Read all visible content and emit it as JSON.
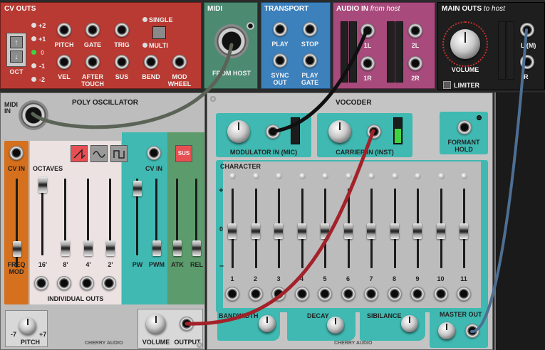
{
  "colors": {
    "cv_outs": "#b83a32",
    "midi": "#4c8a72",
    "transport": "#3c80bc",
    "audio_in": "#a84a7c",
    "main_outs": "#1e1e1e",
    "rack": "#c9c9c9",
    "teal": "#3fb9b2",
    "orange": "#d4701e",
    "green": "#5c9c6c",
    "cable_gray": "#5b6357",
    "cable_black": "#101010",
    "cable_red": "#a3222a",
    "cable_blue": "#4e6f93"
  },
  "cv_outs": {
    "title": "CV OUTS",
    "octave_label": "OCT",
    "octave_values": [
      "+2",
      "+1",
      "0",
      "-1",
      "-2"
    ],
    "active_octave": "0",
    "jacks": [
      "PITCH",
      "GATE",
      "TRIG",
      "VEL",
      "AFTER TOUCH",
      "SUS",
      "BEND",
      "MOD WHEEL"
    ],
    "mode_single": "SINGLE",
    "mode_multi": "MULTI"
  },
  "midi": {
    "title": "MIDI",
    "from_host": "FROM HOST"
  },
  "transport": {
    "title": "TRANSPORT",
    "jacks": [
      "PLAY",
      "STOP",
      "SYNC OUT",
      "PLAY GATE"
    ]
  },
  "audio_in": {
    "title": "AUDIO IN",
    "subtitle": "from host",
    "jacks": [
      "1L",
      "1R",
      "2L",
      "2R"
    ]
  },
  "main_outs": {
    "title": "MAIN OUTS",
    "subtitle": "to host",
    "volume": "VOLUME",
    "limiter": "LIMITER",
    "jacks": [
      "L (M)",
      "R"
    ]
  },
  "poly": {
    "title": "POLY OSCILLATOR",
    "midi_in": "MIDI IN",
    "cv_in": "CV IN",
    "octaves": "OCTAVES",
    "freq_mod": "FREQ MOD",
    "fader_labels": [
      "16'",
      "8'",
      "4'",
      "2'"
    ],
    "individual_outs": "INDIVIDUAL OUTS",
    "cv_in2": "CV IN",
    "sus": "SUS",
    "pw": "PW",
    "pwm": "PWM",
    "atk": "ATK",
    "rel": "REL",
    "pitch": "PITCH",
    "pitch_min": "-7",
    "pitch_max": "+7",
    "volume": "VOLUME",
    "output": "OUTPUT",
    "brand": "CHERRY AUDIO"
  },
  "vocoder": {
    "title": "VOCODER",
    "modulator": "MODULATOR IN (MIC)",
    "carrier": "CARRIER IN (INST)",
    "formant_hold": "FORMANT HOLD",
    "character": "CHARACTER",
    "scale_plus": "+",
    "scale_zero": "0",
    "scale_minus": "–",
    "bands": [
      "1",
      "2",
      "3",
      "4",
      "5",
      "6",
      "7",
      "8",
      "9",
      "10",
      "11"
    ],
    "bandwidth": "BANDWIDTH",
    "decay": "DECAY",
    "sibilance": "SIBILANCE",
    "master_out": "MASTER OUT",
    "brand": "CHERRY AUDIO"
  }
}
